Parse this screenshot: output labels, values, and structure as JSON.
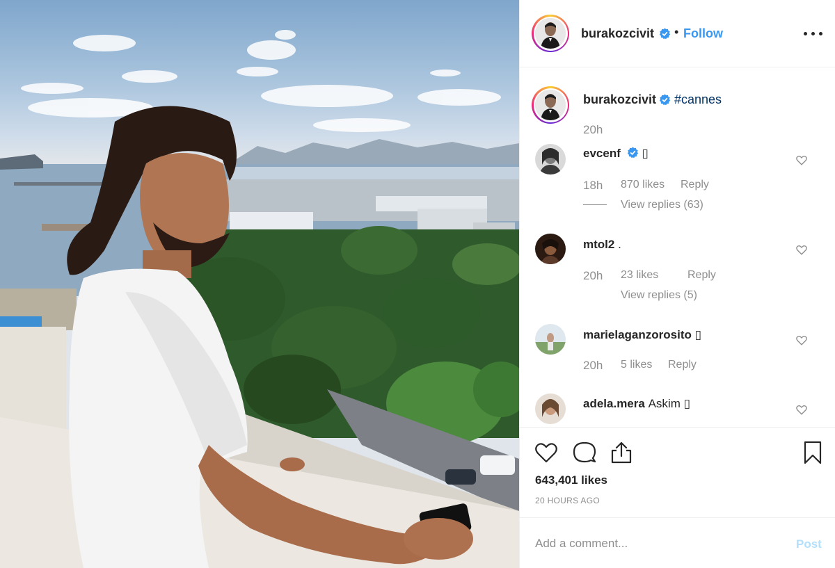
{
  "post": {
    "author": "burakozcivit",
    "follow_label": "Follow",
    "separator": "•",
    "caption_tag": "#cannes",
    "caption_time": "20h",
    "likes": "643,401 likes",
    "posted_ago": "20 HOURS AGO"
  },
  "comments": [
    {
      "user": "evcenf",
      "verified": true,
      "text": "▯",
      "time": "18h",
      "likes": "870 likes",
      "reply": "Reply",
      "view_replies": "View replies (63)"
    },
    {
      "user": "mtol2",
      "verified": false,
      "text": ".",
      "time": "20h",
      "likes": "23 likes",
      "reply": "Reply",
      "view_replies": "View replies (5)"
    },
    {
      "user": "marielaganzorosito",
      "verified": false,
      "text": "▯",
      "time": "20h",
      "likes": "5 likes",
      "reply": "Reply"
    },
    {
      "user": "adela.mera",
      "verified": false,
      "text": "Askim ▯"
    }
  ],
  "comment_box": {
    "placeholder": "Add a comment...",
    "post_label": "Post"
  },
  "icons": {
    "like": "heart-icon",
    "comment": "comment-bubble-icon",
    "share": "share-icon",
    "save": "bookmark-icon",
    "more": "more-options-icon",
    "verified": "verified-badge-icon"
  },
  "colors": {
    "link_blue": "#3897f0",
    "post_disabled": "#b2dffc",
    "secondary_text": "#8e8e8e"
  }
}
